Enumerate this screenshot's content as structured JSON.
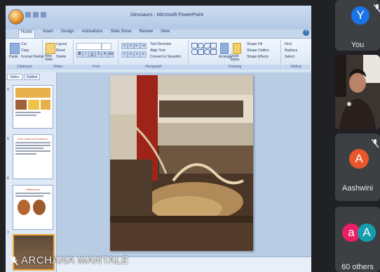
{
  "powerpoint": {
    "title": "Dinosaurs - Microsoft PowerPoint",
    "tabs": [
      "Home",
      "Insert",
      "Design",
      "Animations",
      "Slide Show",
      "Review",
      "View"
    ],
    "clipboard": {
      "paste": "Paste",
      "cut": "Cut",
      "copy": "Copy",
      "format_painter": "Format Painter",
      "label": "Clipboard"
    },
    "slides_group": {
      "new_slide": "New Slide",
      "layout": "Layout",
      "reset": "Reset",
      "delete": "Delete",
      "label": "Slides"
    },
    "font_label": "Font",
    "paragraph": {
      "text_direction": "Text Direction",
      "align_text": "Align Text",
      "convert_smartart": "Convert to SmartArt",
      "label": "Paragraph"
    },
    "drawing": {
      "arrange": "Arrange",
      "quick_styles": "Quick Styles",
      "shape_fill": "Shape Fill",
      "shape_outline": "Shape Outline",
      "shape_effects": "Shape Effects",
      "label": "Drawing"
    },
    "editing": {
      "find": "Find",
      "replace": "Replace",
      "select": "Select",
      "label": "Editing"
    },
    "pane_tabs": [
      "Slides",
      "Outline"
    ],
    "thumbnails": [
      {
        "num": "4"
      },
      {
        "num": "5",
        "heading": "Ever heard of Evolution?"
      },
      {
        "num": "6",
        "heading": "Differences"
      },
      {
        "num": "7"
      }
    ]
  },
  "presenter": {
    "name": "ARCHANA MANTALE"
  },
  "participants": [
    {
      "initial": "Y",
      "name": "You",
      "color": "#1a73e8"
    },
    {
      "initial": "",
      "name": "",
      "color": ""
    },
    {
      "initial": "A",
      "name": "Aashwini",
      "color": "#e8572a"
    },
    {
      "initial_a": "a",
      "initial_b": "A",
      "name": "60 others",
      "color_a": "#e91e63",
      "color_b": "#129eaf"
    }
  ]
}
